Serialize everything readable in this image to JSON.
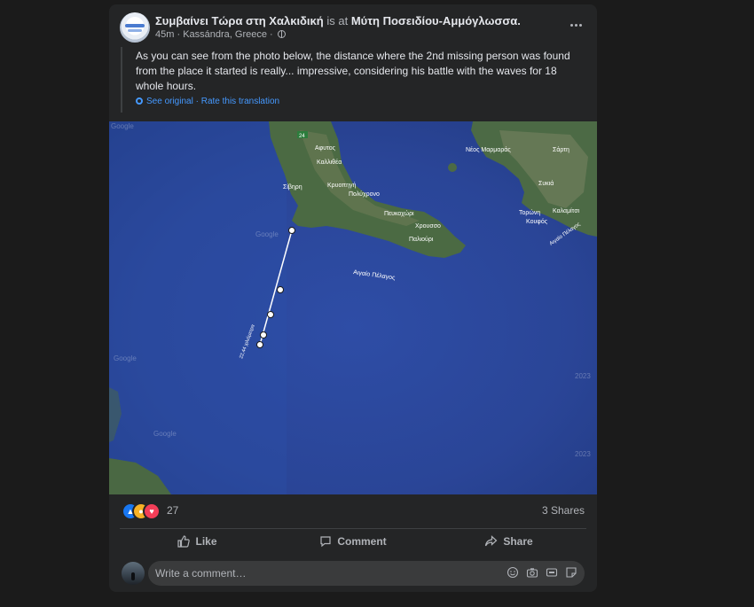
{
  "post": {
    "author": "Συμβαίνει Τώρα στη Χαλκιδική",
    "is_at": "is at",
    "place": "Μύτη Ποσειδίου-Αμμόγλωσσα.",
    "time": "45m",
    "location": "Kassándra, Greece",
    "separator": "·",
    "text": "As you can see from the photo below, the distance where the 2nd missing person was found from the place it started is really... impressive, considering his battle with the waves for 18 whole hours.",
    "see_original": "See original",
    "rate_translation": "Rate this translation"
  },
  "map": {
    "labels": {
      "route_24": "24",
      "afytos": "Αφυτος",
      "kallithea": "Καλλιθέα",
      "nea_marmaras": "Νέος Μαρμαράς",
      "sarti": "Σάρτη",
      "kriopigi": "Κρυοπηγή",
      "sivri": "Σίβηρη",
      "polychrono": "Πολύχρονο",
      "pefkochori": "Πευκοχώρι",
      "sykia": "Συκιά",
      "toroni": "Τορώνη",
      "kalamitsi": "Καλαμίτσι",
      "koufos": "Κουφός",
      "chrousso": "Χρουσσο",
      "paliouri": "Παλιούρι",
      "aegean": "Αιγαίο Πέλαγος",
      "aegean2": "Αιγαίο Πέλαγος",
      "route_label": "22,44 χιλιόμετρα",
      "google1": "Google",
      "google2": "Google",
      "google3": "Google",
      "google4": "Google",
      "year1": "2023",
      "year2": "2023"
    }
  },
  "reactions": {
    "count": "27",
    "shares": "3 Shares"
  },
  "actions": {
    "like": "Like",
    "comment": "Comment",
    "share": "Share"
  },
  "comment": {
    "placeholder": "Write a comment…"
  },
  "colors": {
    "background": "#1b1b1b",
    "card": "#242526",
    "text": "#e4e6eb",
    "secondary": "#b0b3b8",
    "link": "#4599ff",
    "like": "#1877f2",
    "wow": "#f7b125",
    "love": "#f33e58"
  },
  "icons": {
    "more": "more-dots-icon",
    "globe": "globe-icon",
    "gear": "gear-icon",
    "like": "thumbs-up-icon",
    "comment": "speech-bubble-icon",
    "share": "share-arrow-icon",
    "emoji": "emoji-icon",
    "camera": "camera-icon",
    "gif": "gif-icon",
    "sticker": "sticker-icon"
  }
}
